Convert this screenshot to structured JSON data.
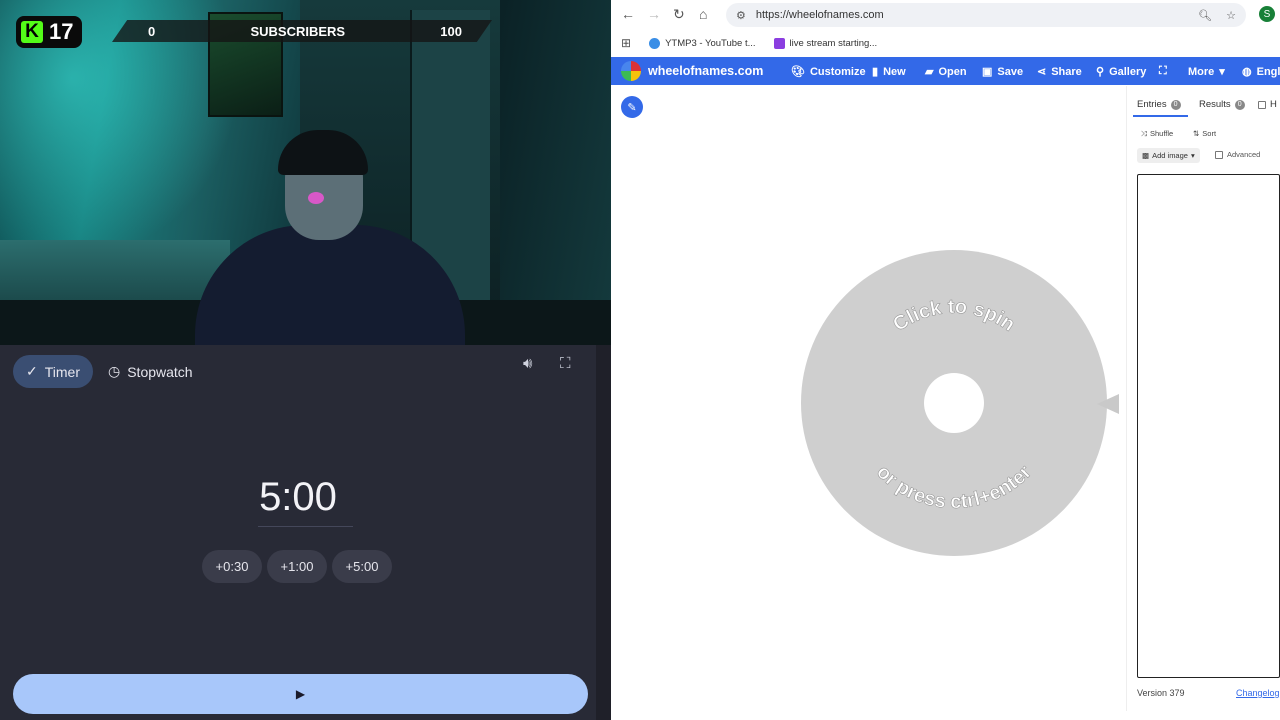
{
  "stream": {
    "kick_count": "17",
    "goal_current": "0",
    "goal_label": "SUBSCRIBERS",
    "goal_target": "100"
  },
  "timer": {
    "tabs": [
      "Timer",
      "Stopwatch"
    ],
    "time": "5:00",
    "add_buttons": [
      "+0:30",
      "+1:00",
      "+5:00"
    ],
    "play_icon": "play-icon"
  },
  "browser": {
    "url": "https://wheelofnames.com",
    "avatar_letter": "S",
    "bookmarks": [
      "YTMP3 - YouTube t...",
      "live stream starting..."
    ]
  },
  "site": {
    "name": "wheelofnames.com",
    "menu": [
      "Customize",
      "New",
      "Open",
      "Save",
      "Share",
      "Gallery",
      "More",
      "Engli"
    ],
    "wheel_text_top": "Click to spin",
    "wheel_text_bottom": "or press ctrl+enter",
    "entries_tab": "Entries",
    "entries_count": "0",
    "results_tab": "Results",
    "results_count": "0",
    "hide_label": "H",
    "shuffle": "Shuffle",
    "sort": "Sort",
    "add_image": "Add image",
    "advanced": "Advanced",
    "entries_value": "",
    "version": "Version 379",
    "changelog": "Changelog",
    "accent": "#3369e8"
  }
}
